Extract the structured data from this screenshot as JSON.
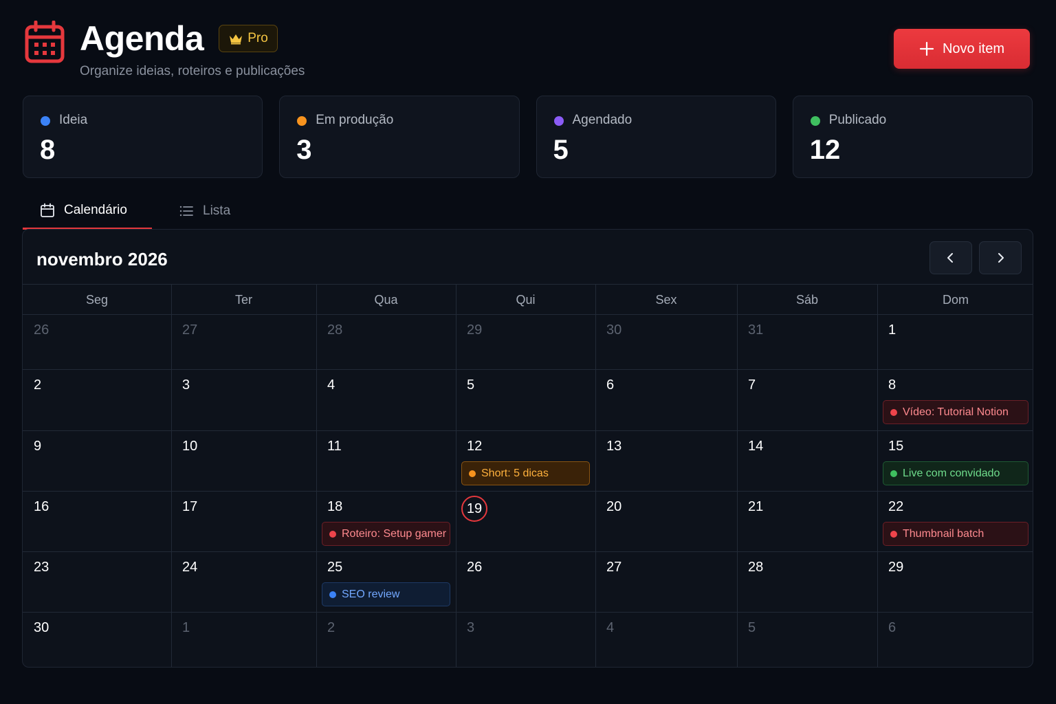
{
  "app": {
    "title": "Agenda",
    "badge": "Pro",
    "subtitle": "Organize ideias, roteiros e publicações",
    "new_button": "Novo item"
  },
  "stats": [
    {
      "label": "Ideia",
      "value": "8",
      "color": "#3b82f6"
    },
    {
      "label": "Em produção",
      "value": "3",
      "color": "#f7931e"
    },
    {
      "label": "Agendado",
      "value": "5",
      "color": "#8b5cf6"
    },
    {
      "label": "Publicado",
      "value": "12",
      "color": "#3fbf5f"
    }
  ],
  "tabs": [
    {
      "label": "Calendário",
      "active": true
    },
    {
      "label": "Lista",
      "active": false
    }
  ],
  "calendar": {
    "month_label": "novembro 2026",
    "weekdays": [
      "Seg",
      "Ter",
      "Qua",
      "Qui",
      "Sex",
      "Sáb",
      "Dom"
    ],
    "weeks": [
      [
        {
          "day": "26",
          "muted": true
        },
        {
          "day": "27",
          "muted": true
        },
        {
          "day": "28",
          "muted": true
        },
        {
          "day": "29",
          "muted": true
        },
        {
          "day": "30",
          "muted": true
        },
        {
          "day": "31",
          "muted": true
        },
        {
          "day": "1"
        }
      ],
      [
        {
          "day": "2"
        },
        {
          "day": "3"
        },
        {
          "day": "4"
        },
        {
          "day": "5"
        },
        {
          "day": "6"
        },
        {
          "day": "7"
        },
        {
          "day": "8",
          "event": {
            "label": "Vídeo: Tutorial Notion",
            "color": "red"
          }
        }
      ],
      [
        {
          "day": "9"
        },
        {
          "day": "10"
        },
        {
          "day": "11"
        },
        {
          "day": "12",
          "event": {
            "label": "Short: 5 dicas",
            "color": "orange"
          }
        },
        {
          "day": "13"
        },
        {
          "day": "14"
        },
        {
          "day": "15",
          "event": {
            "label": "Live com convidado",
            "color": "green"
          }
        }
      ],
      [
        {
          "day": "16"
        },
        {
          "day": "17"
        },
        {
          "day": "18",
          "event": {
            "label": "Roteiro: Setup gamer",
            "color": "red"
          }
        },
        {
          "day": "19",
          "today": true
        },
        {
          "day": "20"
        },
        {
          "day": "21"
        },
        {
          "day": "22",
          "event": {
            "label": "Thumbnail batch",
            "color": "red"
          }
        }
      ],
      [
        {
          "day": "23"
        },
        {
          "day": "24"
        },
        {
          "day": "25",
          "event": {
            "label": "SEO review",
            "color": "blue"
          }
        },
        {
          "day": "26"
        },
        {
          "day": "27"
        },
        {
          "day": "28"
        },
        {
          "day": "29"
        }
      ],
      [
        {
          "day": "30"
        },
        {
          "day": "1",
          "muted": true
        },
        {
          "day": "2",
          "muted": true
        },
        {
          "day": "3",
          "muted": true
        },
        {
          "day": "4",
          "muted": true
        },
        {
          "day": "5",
          "muted": true
        },
        {
          "day": "6",
          "muted": true
        }
      ]
    ]
  },
  "icons": {
    "logo": "calendar-icon",
    "badge": "crown-icon",
    "new": "plus-icon",
    "tab_calendar": "calendar-icon",
    "tab_list": "list-icon",
    "prev": "chevron-left-icon",
    "next": "chevron-right-icon"
  },
  "colors": {
    "accent": "#e5383d",
    "background": "#080c14",
    "card": "#0f141e"
  }
}
